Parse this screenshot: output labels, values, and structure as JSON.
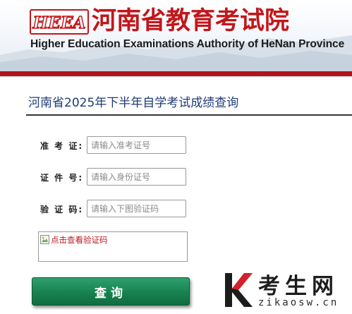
{
  "header": {
    "logo_text": "HEEA",
    "title_cn": "河南省教育考试院",
    "title_en": "Higher Education Examinations Authority of HeNan Province"
  },
  "page": {
    "title": "河南省2025年下半年自学考试成绩查询"
  },
  "form": {
    "admission_label": "准 考 证:",
    "admission_placeholder": "请输入准考证号",
    "id_label": "证 件 号:",
    "id_placeholder": "请输入身份证号",
    "captcha_label": "验 证 码:",
    "captcha_placeholder": "请输入下图验证码",
    "captcha_image_alt": "点击查看验证码",
    "submit_label": "查询"
  },
  "watermark": {
    "cn": "考生网",
    "en": "zikaosw.cn"
  },
  "colors": {
    "brand_red": "#c2161b",
    "title_blue": "#1f3b78",
    "button_green": "#17824f"
  }
}
